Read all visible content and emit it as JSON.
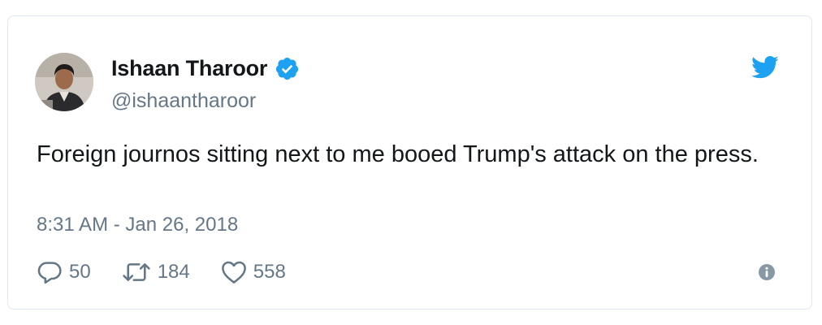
{
  "tweet": {
    "author": {
      "name": "Ishaan Tharoor",
      "handle": "@ishaantharoor",
      "verified": true
    },
    "text": "Foreign journos sitting next to me booed Trump's attack on the press.",
    "timestamp": "8:31 AM - Jan 26, 2018",
    "stats": {
      "replies": "50",
      "retweets": "184",
      "likes": "558"
    }
  },
  "icons": {
    "brand": "twitter-bird-icon",
    "verified": "verified-badge-icon",
    "reply": "reply-icon",
    "retweet": "retweet-icon",
    "like": "heart-icon",
    "info": "info-icon"
  },
  "colors": {
    "brand_blue": "#1da1f2",
    "text_primary": "#14171a",
    "text_secondary": "#657786",
    "border": "#e1e8ed"
  }
}
